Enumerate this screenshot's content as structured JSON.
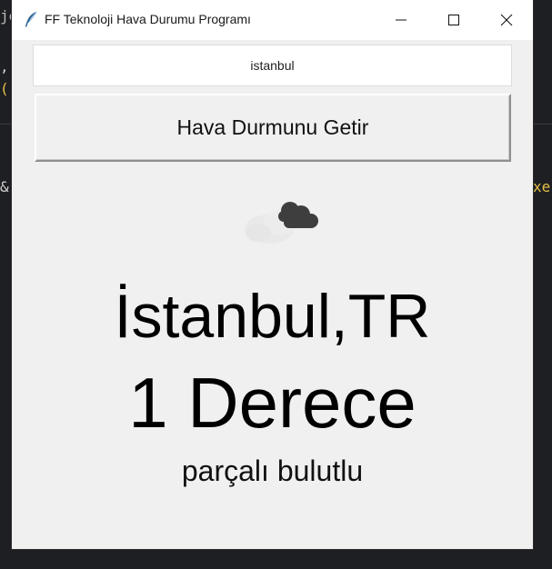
{
  "background": {
    "fragments": [
      "je",
      ",",
      "(",
      "&",
      "xe"
    ]
  },
  "window": {
    "title": "FF Teknoloji Hava Durumu Programı",
    "app_icon": "feather-icon"
  },
  "search": {
    "value": "istanbul"
  },
  "fetch_button": {
    "label": "Hava Durmunu Getir"
  },
  "weather": {
    "icon": "broken-clouds-icon",
    "city": "İstanbul,TR",
    "temperature": "1 Derece",
    "description": "parçalı bulutlu"
  },
  "colors": {
    "window_bg": "#f0f0f0",
    "titlebar_bg": "#ffffff",
    "backdrop": "#1e1f22",
    "cloud_dark": "#3e3e3e",
    "cloud_light": "#e9e9e9"
  }
}
